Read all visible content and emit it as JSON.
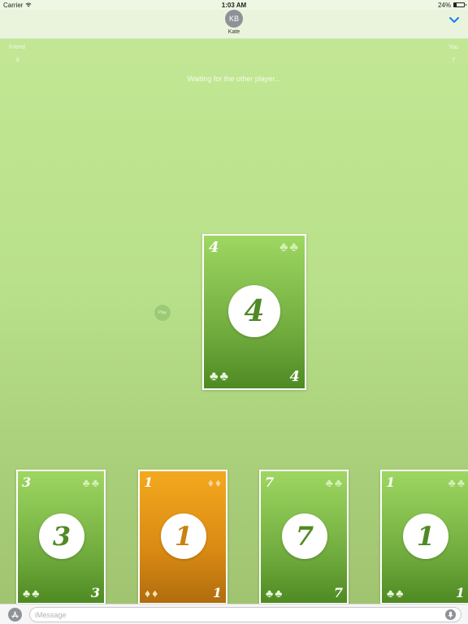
{
  "status_bar": {
    "carrier": "Carrier",
    "time": "1:03 AM",
    "battery_percent": "24%",
    "battery_level": 0.24
  },
  "header": {
    "avatar_initials": "KB",
    "contact_name": "Kate"
  },
  "scores": {
    "friend_label": "Friend",
    "friend_score": "8",
    "you_label": "You",
    "you_score": "7"
  },
  "status_message": "Waiting for the other player...",
  "play_button_label": "Play",
  "center_card": {
    "rank": "4",
    "suit": "clubs",
    "color": "green"
  },
  "hand": [
    {
      "rank": "3",
      "suit": "clubs",
      "color": "green"
    },
    {
      "rank": "1",
      "suit": "diamonds",
      "color": "orange"
    },
    {
      "rank": "7",
      "suit": "clubs",
      "color": "green"
    },
    {
      "rank": "1",
      "suit": "clubs",
      "color": "green"
    }
  ],
  "message_bar": {
    "placeholder": "iMessage"
  },
  "colors": {
    "card_green": "#6faa3d",
    "card_orange": "#d98a13",
    "accent_blue": "#1a7cf5"
  }
}
